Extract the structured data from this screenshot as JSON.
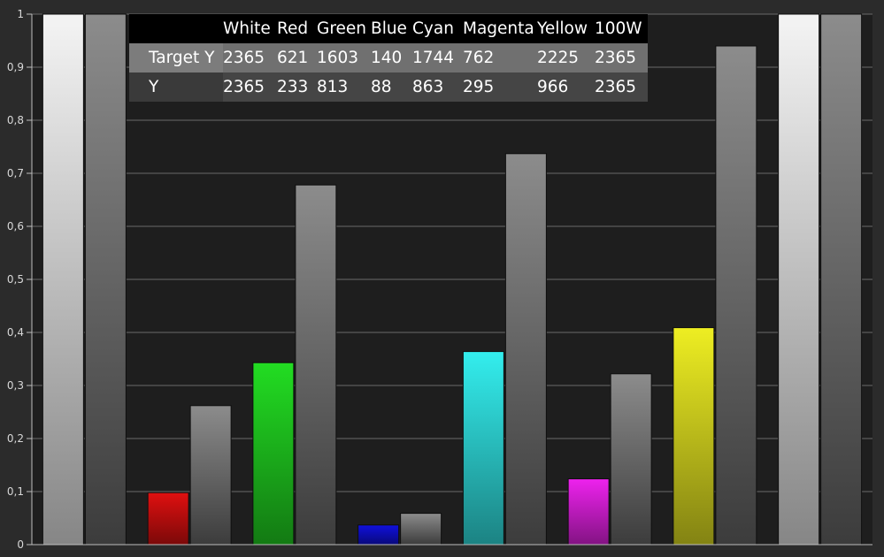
{
  "chart_data": {
    "type": "bar",
    "ylim": [
      0,
      1
    ],
    "yticks": [
      "0",
      "0,1",
      "0,2",
      "0,3",
      "0,4",
      "0,5",
      "0,6",
      "0,7",
      "0,8",
      "0,9",
      "1"
    ],
    "grid": true,
    "categories": [
      "White",
      "Red",
      "Green",
      "Blue",
      "Cyan",
      "Magenta",
      "Yellow",
      "100W"
    ],
    "series": [
      {
        "values": [
          1.0,
          0.098,
          0.343,
          0.037,
          0.364,
          0.124,
          0.409,
          1.0
        ]
      },
      {
        "values": [
          1.0,
          0.262,
          0.678,
          0.059,
          0.737,
          0.322,
          0.94,
          1.0
        ]
      }
    ],
    "bar_colors": [
      "#f4f4f4",
      "#e01010",
      "#22dd22",
      "#1010dd",
      "#33eeee",
      "#ee22ee",
      "#eeee22",
      "#f4f4f4"
    ],
    "reference_color": "#8c8c8c"
  },
  "table": {
    "columns": [
      "White",
      "Red",
      "Green",
      "Blue",
      "Cyan",
      "Magenta",
      "Yellow",
      "100W"
    ],
    "rows": [
      {
        "label": "Target Y",
        "values": [
          "2365",
          "621",
          "1603",
          "140",
          "1744",
          "762",
          "2225",
          "2365"
        ]
      },
      {
        "label": "Y",
        "values": [
          "2365",
          "233",
          "813",
          "88",
          "863",
          "295",
          "966",
          "2365"
        ]
      }
    ]
  }
}
